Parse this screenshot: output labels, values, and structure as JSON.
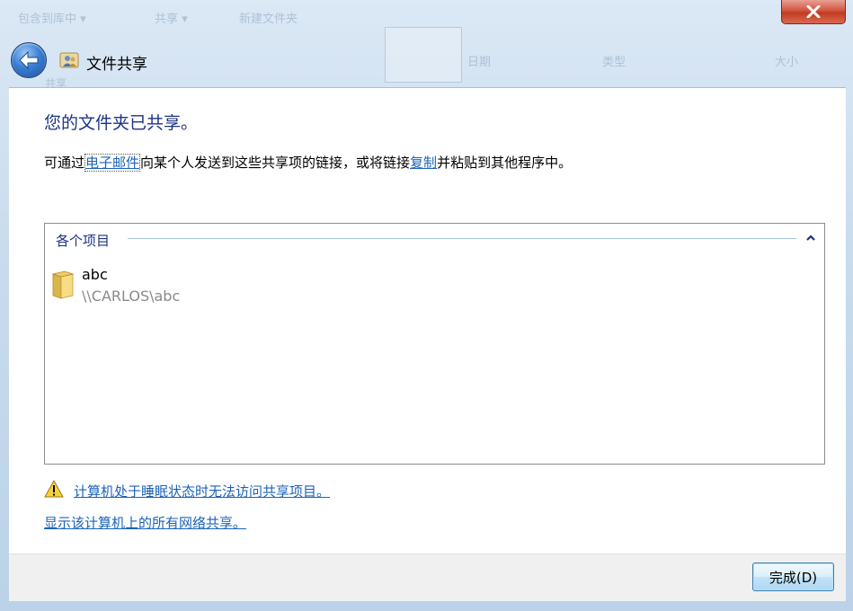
{
  "window": {
    "title": "文件共享"
  },
  "background_explorer": {
    "crumb1": "包含到库中 ▾",
    "crumb2": "共享 ▾",
    "crumb3": "新建文件夹",
    "col_date": "日期",
    "col_type": "类型",
    "col_size": "大小",
    "share_label": "共享"
  },
  "content": {
    "heading": "您的文件夹已共享。",
    "intro_prefix": "可通过",
    "email_link": "电子邮件",
    "intro_middle": "向某个人发送到这些共享项的链接，或将链接",
    "copy_link": "复制",
    "intro_suffix": "并粘贴到其他程序中。"
  },
  "items_group": {
    "header": "各个项目",
    "items": [
      {
        "name": "abc",
        "path": "\\\\CARLOS\\abc"
      }
    ]
  },
  "links": {
    "sleep_warning": "计算机处于睡眠状态时无法访问共享项目。",
    "show_all_shares": "显示该计算机上的所有网络共享。"
  },
  "footer": {
    "done_button": "完成(D)"
  },
  "colors": {
    "heading": "#1e3287",
    "link": "#1c63b8",
    "close_button": "#c23b22"
  },
  "icons": {
    "back": "back-arrow-icon",
    "title": "users-share-icon",
    "collapse": "chevron-up-icon",
    "folder": "folder-icon",
    "warning": "warning-icon",
    "close": "close-icon"
  }
}
